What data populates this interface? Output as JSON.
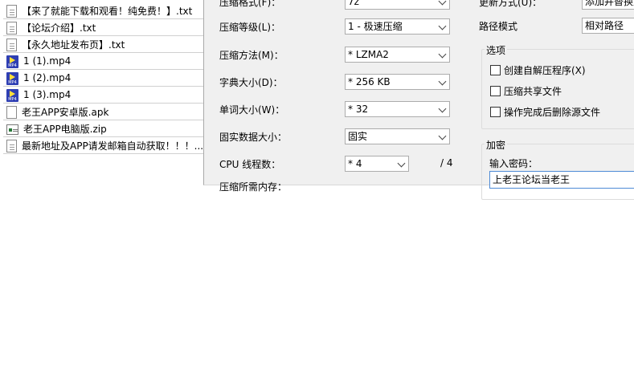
{
  "files": [
    {
      "name": "【来了就能下载和观看！纯免费！】.txt",
      "icon": "txt-file-icon"
    },
    {
      "name": "【论坛介绍】.txt",
      "icon": "txt-file-icon"
    },
    {
      "name": "【永久地址发布页】.txt",
      "icon": "txt-file-icon"
    },
    {
      "name": "1 (1).mp4",
      "icon": "mp4-file-icon"
    },
    {
      "name": "1 (2).mp4",
      "icon": "mp4-file-icon"
    },
    {
      "name": "1 (3).mp4",
      "icon": "mp4-file-icon"
    },
    {
      "name": "老王APP安卓版.apk",
      "icon": "apk-file-icon"
    },
    {
      "name": "老王APP电脑版.zip",
      "icon": "zip-file-icon"
    },
    {
      "name": "最新地址及APP请发邮箱自动获取！！！....",
      "icon": "txt-file-icon"
    }
  ],
  "dialog": {
    "format_label": "压缩格式(F)：",
    "format_value": "7z",
    "level_label": "压缩等级(L)：",
    "level_value": "1 - 极速压缩",
    "method_label": "压缩方法(M)：",
    "method_value": "* LZMA2",
    "dict_label": "字典大小(D)：",
    "dict_value": "* 256 KB",
    "word_label": "单词大小(W)：",
    "word_value": "* 32",
    "solid_label": "固实数据大小：",
    "solid_value": "固实",
    "cpu_label": "CPU 线程数：",
    "cpu_value": "* 4",
    "cpu_total": "/ 4",
    "memory_label": "压缩所需内存：",
    "update_label": "更新方式(U)：",
    "update_value": "添加并替换文件",
    "path_label": "路径模式",
    "path_value": "相对路径",
    "options_title": "选项",
    "options": [
      "创建自解压程序(X)",
      "压缩共享文件",
      "操作完成后删除源文件"
    ],
    "encrypt_title": "加密",
    "password_label": "输入密码：",
    "password_value": "上老王论坛当老王"
  }
}
